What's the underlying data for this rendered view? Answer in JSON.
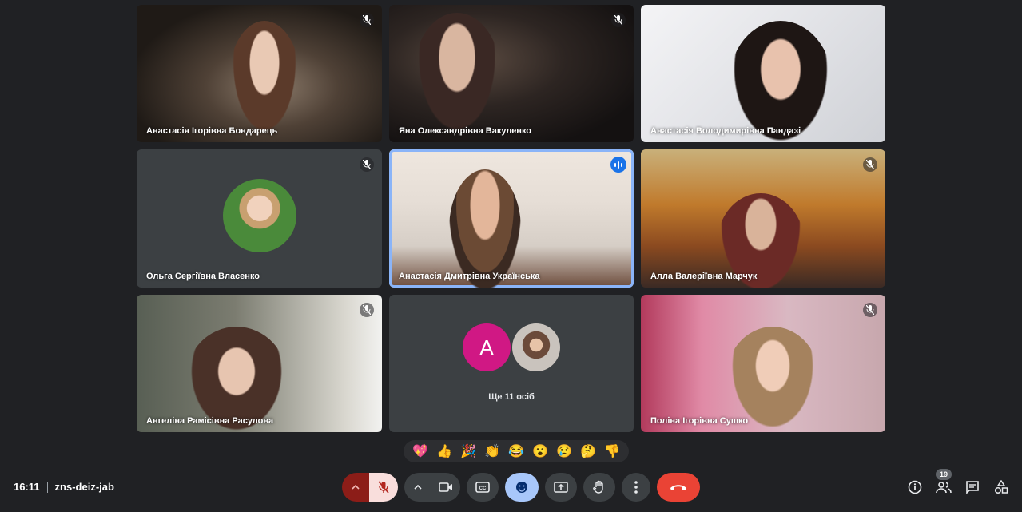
{
  "participants": [
    {
      "name": "Анастасія Ігорівна Бондарець",
      "muted": true
    },
    {
      "name": "Яна Олександрівна Вакуленко",
      "muted": true
    },
    {
      "name": "Анастасія Володимирівна Пандазі",
      "muted": false
    },
    {
      "name": "Ольга Сергіївна Власенко",
      "muted": true
    },
    {
      "name": "Анастасія Дмитрівна Українська",
      "speaking": true
    },
    {
      "name": "Алла Валеріївна Марчук",
      "muted": true
    },
    {
      "name": "Ангеліна Рамісівна Расулова",
      "muted": true
    },
    {
      "name": "Поліна Ігорівна Сушко",
      "muted": true
    }
  ],
  "more": {
    "avatar_letter": "A",
    "label": "Ще 11 осіб"
  },
  "reactions": [
    "💖",
    "👍",
    "🎉",
    "👏",
    "😂",
    "😮",
    "😢",
    "🤔",
    "👎"
  ],
  "meeting": {
    "time": "16:11",
    "code": "zns-deiz-jab"
  },
  "people_count": "19",
  "colors": {
    "end_call": "#ea4335",
    "mic_off": "#f9dedc",
    "active_outline": "#8ab4f8",
    "reactions_active": "#a8c7fa"
  }
}
